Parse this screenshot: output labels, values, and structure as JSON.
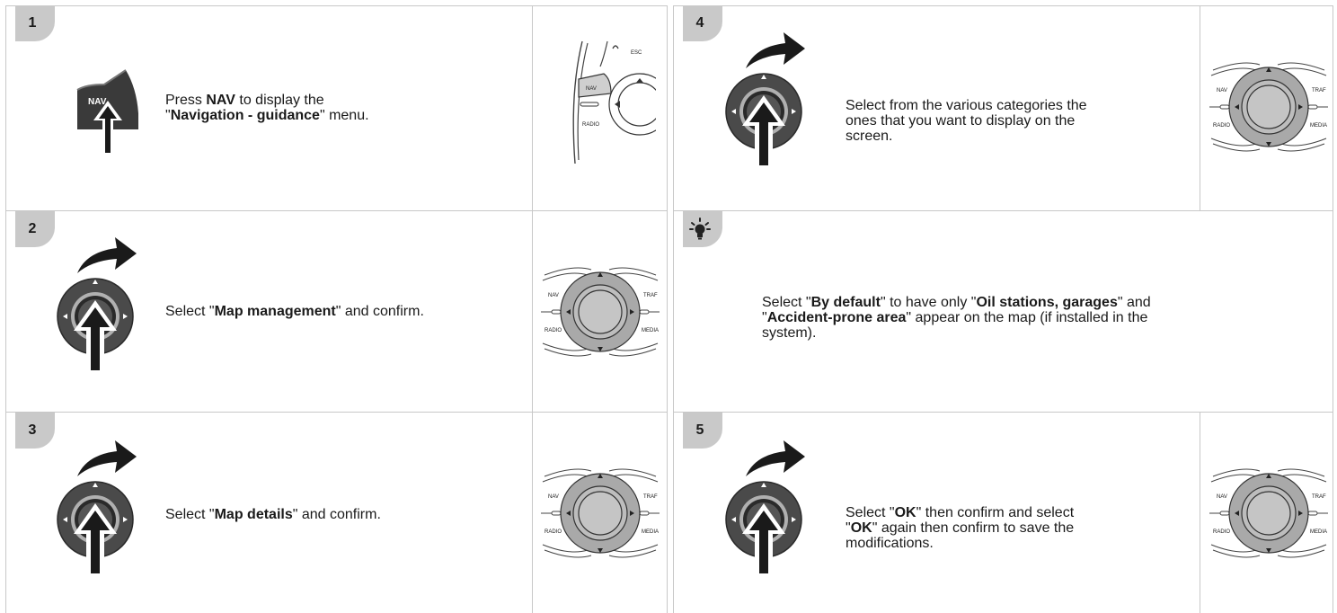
{
  "steps": [
    {
      "num": "1",
      "text_parts": [
        "Press ",
        "NAV",
        " to display the\n\"",
        "Navigation - guidance",
        "\" menu."
      ],
      "bold": [
        1,
        3
      ]
    },
    {
      "num": "2",
      "text_parts": [
        "Select \"",
        "Map management",
        "\" and confirm."
      ],
      "bold": [
        1
      ]
    },
    {
      "num": "3",
      "text_parts": [
        "Select \"",
        "Map details",
        "\" and confirm."
      ],
      "bold": [
        1
      ]
    },
    {
      "num": "4",
      "text_parts": [
        "Select from the various categories the\nones that you want to display on the\nscreen."
      ],
      "bold": []
    },
    {
      "num": "",
      "text_parts": [
        "Select \"",
        "By default",
        "\" to have only \"",
        "Oil stations, garages",
        "\" and\n\"",
        "Accident-prone area",
        "\" appear on the map (if installed in the\nsystem)."
      ],
      "bold": [
        1,
        3,
        5
      ]
    },
    {
      "num": "5",
      "text_parts": [
        "Select \"",
        "OK",
        "\" then confirm and select\n\"",
        "OK",
        "\" again then confirm to save the\nmodifications."
      ],
      "bold": [
        1,
        3
      ]
    }
  ],
  "labels": {
    "nav": "NAV",
    "traf": "TRAF",
    "radio": "RADIO",
    "media": "MEDIA",
    "esc": "ESC"
  },
  "icons": {
    "tip": "lightbulb-icon",
    "rotate": "rotate-arrow-icon",
    "press": "press-arrow-icon"
  }
}
